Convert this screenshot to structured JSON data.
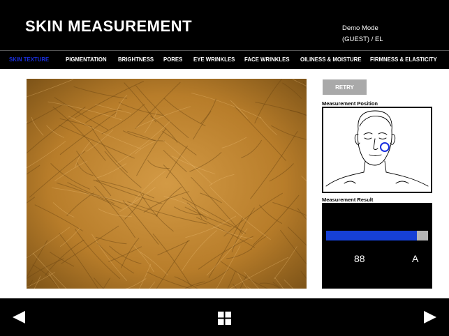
{
  "header": {
    "title": "SKIN MEASUREMENT",
    "mode": "Demo Mode",
    "user": "(GUEST) / EL"
  },
  "tabs": [
    {
      "label": "SKIN TEXTURE",
      "active": true
    },
    {
      "label": "PIGMENTATION",
      "active": false
    },
    {
      "label": "BRIGHTNESS",
      "active": false
    },
    {
      "label": "PORES",
      "active": false
    },
    {
      "label": "EYE WRINKLES",
      "active": false
    },
    {
      "label": "FACE WRINKLES",
      "active": false
    },
    {
      "label": "OILINESS & MOISTURE",
      "active": false
    },
    {
      "label": "FIRMNESS & ELASTICITY",
      "active": false
    }
  ],
  "actions": {
    "retry_label": "RETRY"
  },
  "measurement_position": {
    "label": "Measurement Position"
  },
  "measurement_result": {
    "label": "Measurement Result",
    "score": "88",
    "grade": "A",
    "level": 0.89
  },
  "footer": {
    "prev_icon": "left-arrow-icon",
    "menu_icon": "grid-icon",
    "next_icon": "right-arrow-icon"
  },
  "colors": {
    "active_tab": "#1a2fe0",
    "bar_fill": "#1640d6",
    "bar_track": "#b5b5b5",
    "retry_bg": "#a9a9a9",
    "skin": "#b87d2a"
  }
}
